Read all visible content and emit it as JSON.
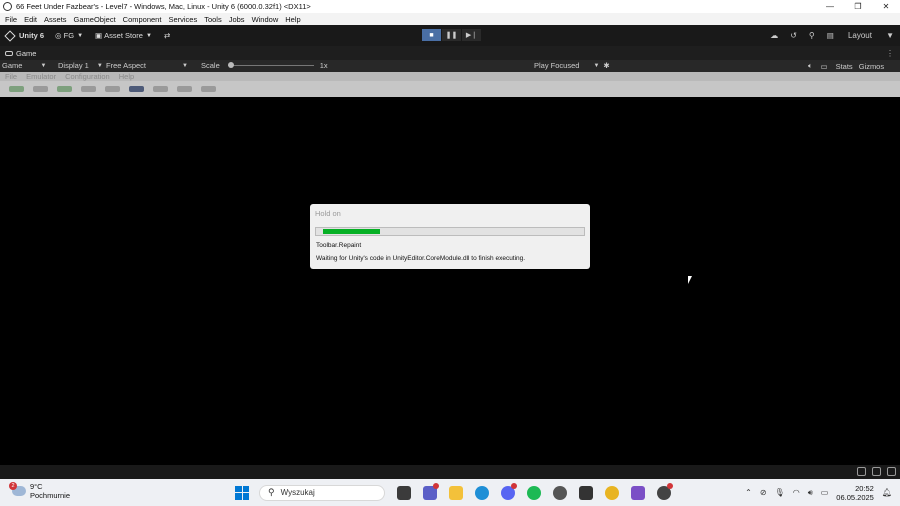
{
  "window": {
    "title": "66 Feet Under Fazbear's - Level7 - Windows, Mac, Linux - Unity 6 (6000.0.32f1) <DX11>",
    "controls": [
      "—",
      "❐",
      "✕"
    ]
  },
  "menubar": [
    "File",
    "Edit",
    "Assets",
    "GameObject",
    "Component",
    "Services",
    "Tools",
    "Jobs",
    "Window",
    "Help"
  ],
  "toolbar": {
    "unity_label": "Unity 6",
    "account": "FG",
    "asset_store": "Asset Store",
    "layout": "Layout"
  },
  "game_tab": {
    "label": "Game"
  },
  "game_controls": {
    "mode": "Game",
    "display": "Display 1",
    "aspect": "Free Aspect",
    "scale_label": "Scale",
    "scale_value": "1x",
    "play_mode": "Play Focused",
    "stats": "Stats",
    "gizmos": "Gizmos"
  },
  "emulator_menu": [
    "File",
    "Emulator",
    "Configuration",
    "Help"
  ],
  "dialog": {
    "title": "Hold on",
    "progress": 0.22,
    "operation": "Toolbar.Repaint",
    "message": "Waiting for Unity's code in UnityEditor.CoreModule.dll to finish executing."
  },
  "taskbar": {
    "weather_temp": "9°C",
    "weather_desc": "Pochmurnie",
    "weather_badge": "2",
    "search_placeholder": "Wyszukaj",
    "time": "20:52",
    "date": "06.05.2025"
  },
  "colors": {
    "progress_fill": "#06b025",
    "editor_dark": "#191919",
    "play_active": "#4a6fa5"
  }
}
